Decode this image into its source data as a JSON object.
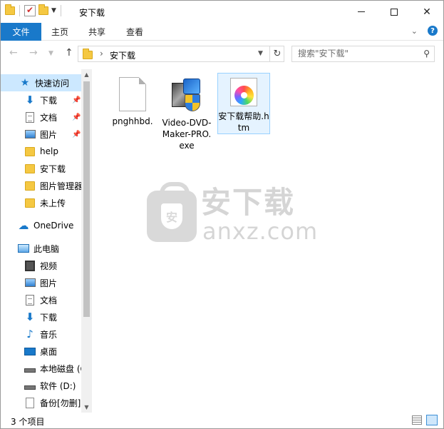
{
  "window": {
    "title": "安下载"
  },
  "ribbon": {
    "file_tab": "文件",
    "home_tab": "主页",
    "share_tab": "共享",
    "view_tab": "查看",
    "expand_glyph": "⌄",
    "help_glyph": "?"
  },
  "address": {
    "path": "安下载",
    "search_placeholder": "搜索\"安下载\""
  },
  "nav": {
    "quick_access": "快速访问",
    "items": [
      {
        "label": "下载",
        "icon": "download-icon",
        "pinned": true
      },
      {
        "label": "文档",
        "icon": "document-icon",
        "pinned": true
      },
      {
        "label": "图片",
        "icon": "pictures-icon",
        "pinned": true
      },
      {
        "label": "help",
        "icon": "folder-icon",
        "pinned": false
      },
      {
        "label": "安下载",
        "icon": "folder-icon",
        "pinned": false
      },
      {
        "label": "图片管理器",
        "icon": "folder-icon",
        "pinned": false
      },
      {
        "label": "未上传",
        "icon": "folder-icon",
        "pinned": false
      }
    ],
    "onedrive": "OneDrive",
    "this_pc": "此电脑",
    "pc_items": [
      {
        "label": "视频",
        "icon": "video-icon"
      },
      {
        "label": "图片",
        "icon": "pictures-icon"
      },
      {
        "label": "文档",
        "icon": "document-icon"
      },
      {
        "label": "下载",
        "icon": "download-icon"
      },
      {
        "label": "音乐",
        "icon": "music-icon"
      },
      {
        "label": "桌面",
        "icon": "desktop-icon"
      },
      {
        "label": "本地磁盘 (C:)",
        "icon": "drive-icon"
      },
      {
        "label": "软件 (D:)",
        "icon": "drive-icon"
      },
      {
        "label": "备份[勿删]",
        "icon": "file-icon"
      }
    ]
  },
  "files": [
    {
      "name": "pnghhbd.",
      "icon": "blank-file-icon"
    },
    {
      "name": "Video-DVD-Maker-PRO.exe",
      "icon": "installer-icon"
    },
    {
      "name": "安下载帮助.htm",
      "icon": "htm-file-icon",
      "selected": true
    }
  ],
  "watermark": {
    "title": "安下载",
    "domain": "anxz.com",
    "badge": "安"
  },
  "status": {
    "count": "3 个项目"
  },
  "colors": {
    "accent": "#1979ca",
    "selection": "#cce8ff",
    "folder": "#f5c842"
  }
}
